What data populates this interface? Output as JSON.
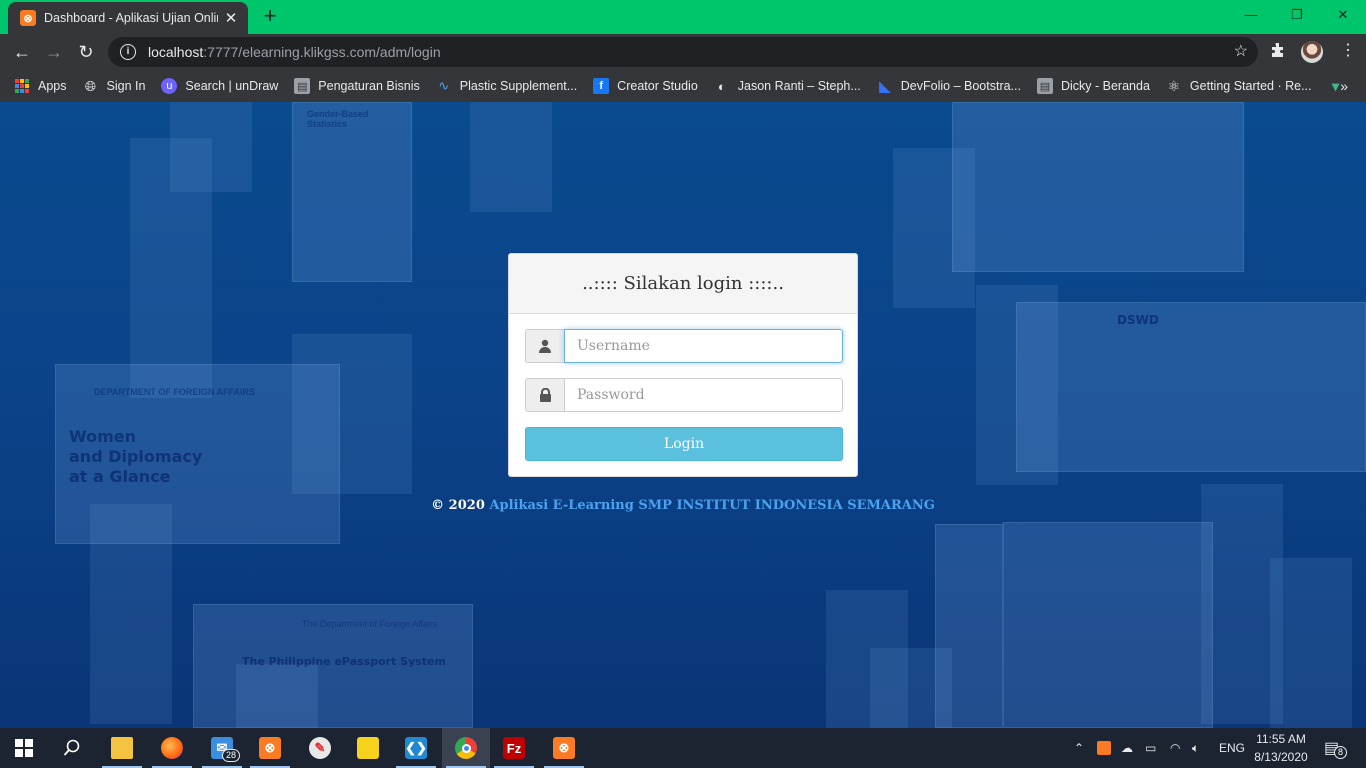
{
  "browser": {
    "tab_title": "Dashboard - Aplikasi Ujian Online",
    "tab_close": "✕",
    "new_tab": "+",
    "url_host": "localhost",
    "url_path": ":7777/elearning.klikgss.com/adm/login",
    "window_controls": {
      "minimize": "—",
      "restore": "❐",
      "close": "✕"
    },
    "bookmarks": [
      {
        "label": "Apps",
        "icon": "apps-grid-icon"
      },
      {
        "label": "Sign In",
        "icon": "globe-icon"
      },
      {
        "label": "Search | unDraw",
        "icon": "undraw-icon"
      },
      {
        "label": "Pengaturan Bisnis",
        "icon": "page-icon"
      },
      {
        "label": "Plastic Supplement...",
        "icon": "wave-icon"
      },
      {
        "label": "Creator Studio",
        "icon": "facebook-icon"
      },
      {
        "label": "Jason Ranti – Steph...",
        "icon": "music-icon"
      },
      {
        "label": "DevFolio – Bootstra...",
        "icon": "devfolio-icon"
      },
      {
        "label": "Dicky - Beranda",
        "icon": "page-icon"
      },
      {
        "label": "Getting Started · Re...",
        "icon": "react-icon"
      }
    ],
    "bookmarks_more": "»"
  },
  "background": {
    "posters": [
      {
        "title": "Women\nand Diplomacy\nat a Glance",
        "header": "DEPARTMENT OF FOREIGN AFFAIRS"
      },
      {
        "title": "The Philippine ePassport System",
        "header": "The Department of Foreign Affairs"
      },
      {
        "title": "DSWD",
        "header": ""
      },
      {
        "title": "Gender-Based Statistics",
        "header": ""
      }
    ]
  },
  "login": {
    "heading": "..:::: Silakan login ::::..",
    "username_placeholder": "Username",
    "password_placeholder": "Password",
    "button_label": "Login"
  },
  "footer": {
    "copyright": "© 2020",
    "app_name": "Aplikasi E-Learning SMP INSTITUT INDONESIA SEMARANG"
  },
  "taskbar": {
    "mail_badge": "28",
    "language": "ENG",
    "time": "11:55 AM",
    "date": "8/13/2020",
    "notification_count": "8"
  },
  "colors": {
    "titlebar": "#00c66b",
    "chrome_dark": "#35363a",
    "login_button": "#5bc0de",
    "footer_link": "#4aa3f0",
    "page_bg": "#0b4389"
  }
}
